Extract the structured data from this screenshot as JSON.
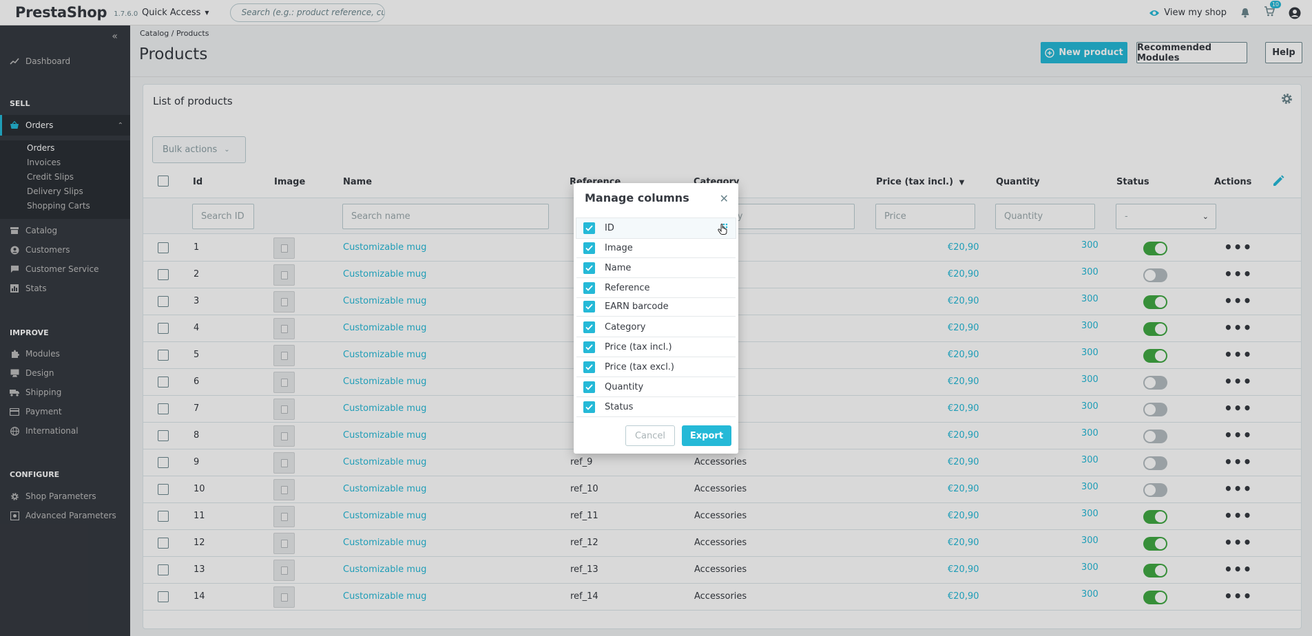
{
  "header": {
    "brand": "PrestaShop",
    "version": "1.7.6.0",
    "quick_access": "Quick Access",
    "search_placeholder": "Search (e.g.: product reference, customer",
    "view_shop": "View my shop",
    "cart_badge": "10"
  },
  "sidebar": {
    "dashboard": "Dashboard",
    "sell_section": "SELL",
    "orders": "Orders",
    "sub": [
      "Orders",
      "Invoices",
      "Credit Slips",
      "Delivery Slips",
      "Shopping Carts"
    ],
    "catalog": "Catalog",
    "customers": "Customers",
    "customer_service": "Customer Service",
    "stats": "Stats",
    "improve_section": "IMPROVE",
    "modules": "Modules",
    "design": "Design",
    "shipping": "Shipping",
    "payment": "Payment",
    "international": "International",
    "configure_section": "CONFIGURE",
    "shop_parameters": "Shop Parameters",
    "advanced_parameters": "Advanced Parameters"
  },
  "page": {
    "breadcrumb_catalog": "Catalog",
    "breadcrumb_sep": "/",
    "breadcrumb_products": "Products",
    "title": "Products",
    "new_product": "New product",
    "recommended_modules": "Recommended Modules",
    "help": "Help"
  },
  "card": {
    "title": "List of products",
    "bulk_actions": "Bulk actions"
  },
  "table": {
    "headers": {
      "id": "Id",
      "image": "Image",
      "name": "Name",
      "reference": "Reference",
      "category": "Category",
      "price": "Price (tax incl.)",
      "quantity": "Quantity",
      "status": "Status",
      "actions": "Actions"
    },
    "filters": {
      "id": "Search ID",
      "name": "Search name",
      "category": "Category",
      "price": "Price",
      "quantity": "Quantity",
      "status": "-"
    },
    "rows": [
      {
        "id": "1",
        "name": "Customizable mug",
        "reference": "",
        "category": "",
        "price": "€20,90",
        "quantity": "300",
        "active": true
      },
      {
        "id": "2",
        "name": "Customizable mug",
        "reference": "",
        "category": "",
        "price": "€20,90",
        "quantity": "300",
        "active": false
      },
      {
        "id": "3",
        "name": "Customizable mug",
        "reference": "",
        "category": "",
        "price": "€20,90",
        "quantity": "300",
        "active": true
      },
      {
        "id": "4",
        "name": "Customizable mug",
        "reference": "",
        "category": "",
        "price": "€20,90",
        "quantity": "300",
        "active": true
      },
      {
        "id": "5",
        "name": "Customizable mug",
        "reference": "",
        "category": "",
        "price": "€20,90",
        "quantity": "300",
        "active": true
      },
      {
        "id": "6",
        "name": "Customizable mug",
        "reference": "",
        "category": "",
        "price": "€20,90",
        "quantity": "300",
        "active": false
      },
      {
        "id": "7",
        "name": "Customizable mug",
        "reference": "",
        "category": "",
        "price": "€20,90",
        "quantity": "300",
        "active": false
      },
      {
        "id": "8",
        "name": "Customizable mug",
        "reference": "",
        "category": "",
        "price": "€20,90",
        "quantity": "300",
        "active": false
      },
      {
        "id": "9",
        "name": "Customizable mug",
        "reference": "ref_9",
        "category": "Accessories",
        "price": "€20,90",
        "quantity": "300",
        "active": false
      },
      {
        "id": "10",
        "name": "Customizable mug",
        "reference": "ref_10",
        "category": "Accessories",
        "price": "€20,90",
        "quantity": "300",
        "active": false
      },
      {
        "id": "11",
        "name": "Customizable mug",
        "reference": "ref_11",
        "category": "Accessories",
        "price": "€20,90",
        "quantity": "300",
        "active": true
      },
      {
        "id": "12",
        "name": "Customizable mug",
        "reference": "ref_12",
        "category": "Accessories",
        "price": "€20,90",
        "quantity": "300",
        "active": true
      },
      {
        "id": "13",
        "name": "Customizable mug",
        "reference": "ref_13",
        "category": "Accessories",
        "price": "€20,90",
        "quantity": "300",
        "active": true
      },
      {
        "id": "14",
        "name": "Customizable mug",
        "reference": "ref_14",
        "category": "Accessories",
        "price": "€20,90",
        "quantity": "300",
        "active": true
      }
    ]
  },
  "modal": {
    "title": "Manage columns",
    "columns": [
      {
        "label": "ID",
        "checked": true
      },
      {
        "label": "Image",
        "checked": true
      },
      {
        "label": "Name",
        "checked": true
      },
      {
        "label": "Reference",
        "checked": true
      },
      {
        "label": "EARN barcode",
        "checked": true
      },
      {
        "label": "Category",
        "checked": true
      },
      {
        "label": "Price (tax incl.)",
        "checked": true
      },
      {
        "label": "Price (tax excl.)",
        "checked": true
      },
      {
        "label": "Quantity",
        "checked": true
      },
      {
        "label": "Status",
        "checked": true
      }
    ],
    "cancel": "Cancel",
    "export": "Export"
  },
  "colors": {
    "accent": "#25b9d7",
    "sidebar": "#363a41",
    "toggle_on": "#41a844",
    "toggle_off": "#b4bdc1"
  }
}
